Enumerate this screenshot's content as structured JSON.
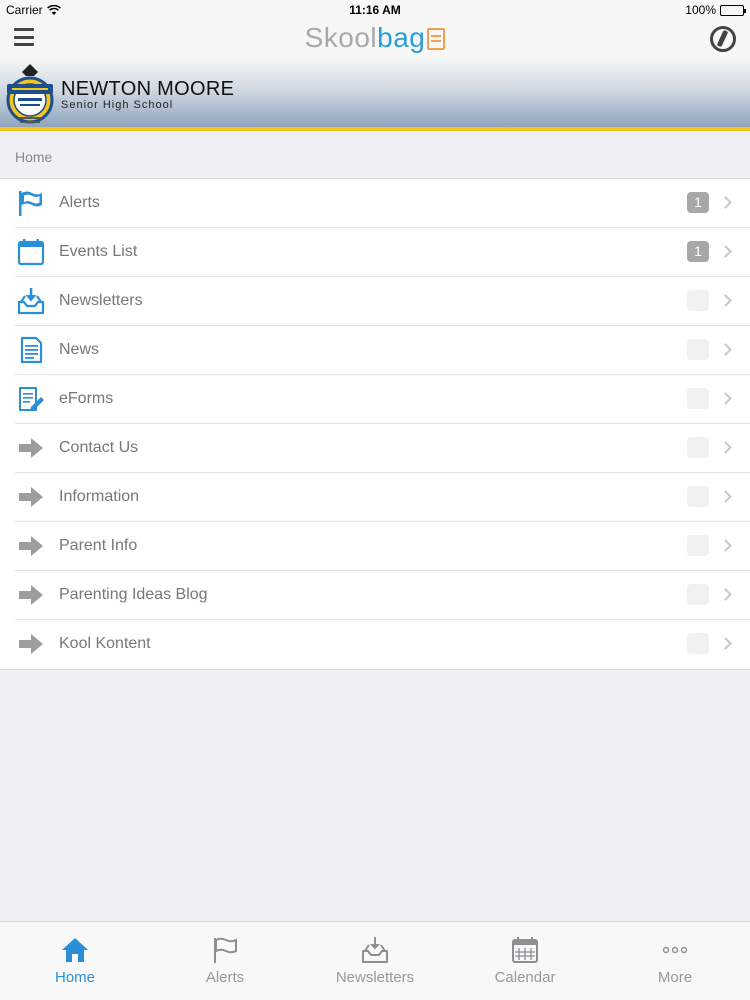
{
  "status_bar": {
    "carrier": "Carrier",
    "time": "11:16 AM",
    "battery": "100%"
  },
  "app": {
    "brand_part1": "Skool",
    "brand_part2": "bag",
    "brand_color": "#2a9ed8",
    "accent_color": "#f2c61c"
  },
  "school": {
    "name": "NEWTON MOORE",
    "subtitle": "Senior High School",
    "logo_icon": "school-crest-icon"
  },
  "breadcrumb": "Home",
  "menu": [
    {
      "label": "Alerts",
      "icon": "flag-icon",
      "count": "1",
      "active": true
    },
    {
      "label": "Events List",
      "icon": "calendar-icon",
      "count": "1",
      "active": true
    },
    {
      "label": "Newsletters",
      "icon": "inbox-download-icon",
      "count": "0",
      "active": false
    },
    {
      "label": "News",
      "icon": "document-icon",
      "count": "0",
      "active": false
    },
    {
      "label": "eForms",
      "icon": "form-pen-icon",
      "count": "0",
      "active": false
    },
    {
      "label": "Contact Us",
      "icon": "arrow-right-icon",
      "count": "0",
      "active": false
    },
    {
      "label": "Information",
      "icon": "arrow-right-icon",
      "count": "0",
      "active": false
    },
    {
      "label": "Parent Info",
      "icon": "arrow-right-icon",
      "count": "0",
      "active": false
    },
    {
      "label": "Parenting Ideas Blog",
      "icon": "arrow-right-icon",
      "count": "0",
      "active": false
    },
    {
      "label": "Kool Kontent",
      "icon": "arrow-right-icon",
      "count": "0",
      "active": false
    }
  ],
  "tabs": [
    {
      "label": "Home",
      "icon": "home-icon",
      "selected": true
    },
    {
      "label": "Alerts",
      "icon": "flag-icon",
      "selected": false
    },
    {
      "label": "Newsletters",
      "icon": "inbox-download-icon",
      "selected": false
    },
    {
      "label": "Calendar",
      "icon": "calendar-icon",
      "selected": false
    },
    {
      "label": "More",
      "icon": "more-dots-icon",
      "selected": false
    }
  ]
}
